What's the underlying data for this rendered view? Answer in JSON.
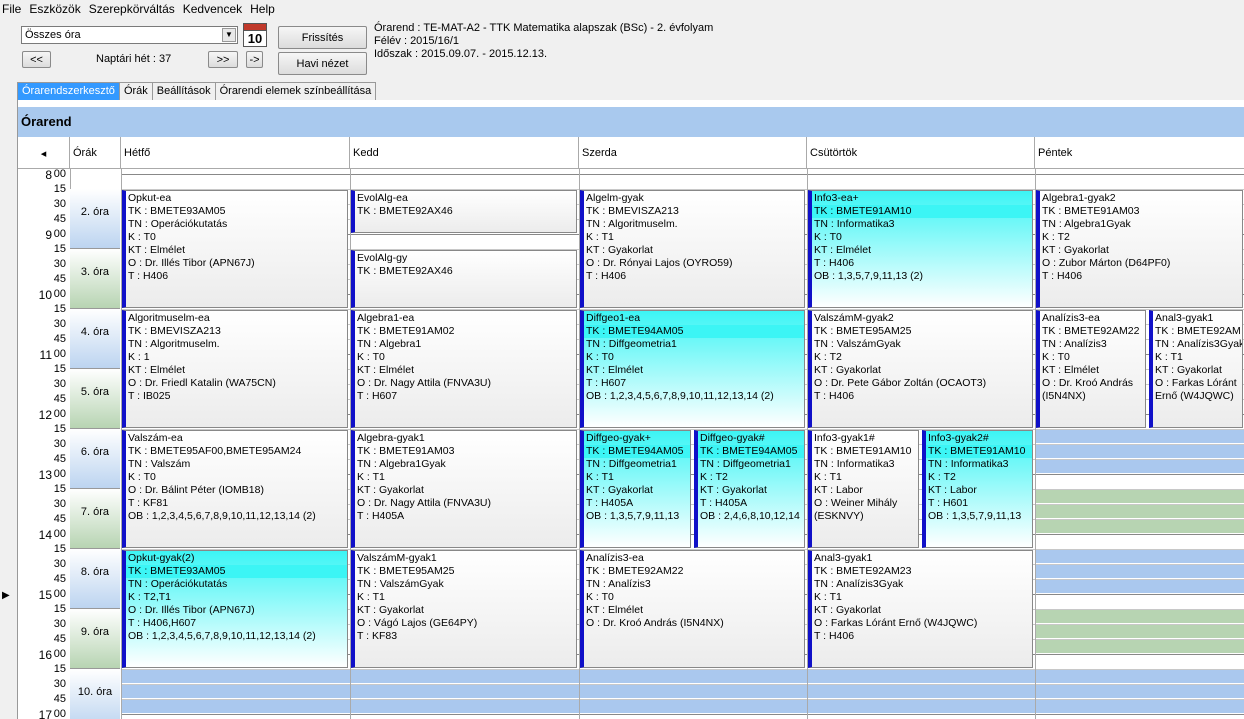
{
  "menu": [
    "File",
    "Eszközök",
    "Szerepkörváltás",
    "Kedvencek",
    "Help"
  ],
  "toolbar": {
    "combo": "Összes óra",
    "prev": "<<",
    "next": ">>",
    "next_single": "->",
    "week": "Naptári hét : 37",
    "cal_num": "10",
    "refresh": "Frissítés",
    "monthly": "Havi nézet",
    "info_line1": "Órarend : TE-MAT-A2 - TTK Matematika alapszak (BSc) - 2. évfolyam",
    "info_line2": "Félév : 2015/16/1",
    "info_line3": "Időszak : 2015.09.07. - 2015.12.13."
  },
  "tabs": [
    "Órarendszerkesztő",
    "Órák",
    "Beállítások",
    "Órarendi elemek színbeállítása"
  ],
  "title": "Órarend",
  "headers": {
    "nav": "◂",
    "orak": "Órák",
    "days": [
      "Hétfő",
      "Kedd",
      "Szerda",
      "Csütörtök",
      "Péntek"
    ]
  },
  "times": {
    "hours": [
      "8",
      "9",
      "10",
      "11",
      "12",
      "13",
      "14",
      "15",
      "16",
      "17"
    ],
    "mins": [
      "00",
      "15",
      "30",
      "45"
    ]
  },
  "ora_labels": [
    "2. óra",
    "3. óra",
    "4. óra",
    "5. óra",
    "6. óra",
    "7. óra",
    "8. óra",
    "9. óra",
    "10. óra"
  ],
  "events": [
    {
      "lines": [
        "Opkut-ea",
        "TK : BMETE93AM05",
        "TN : Operációkutatás",
        "K : T0",
        "KT : Elmélet",
        "O :  Dr. Illés Tibor (APN67J)",
        "T : H406"
      ]
    },
    {
      "lines": [
        "EvolAlg-ea",
        "TK : BMETE92AX46"
      ]
    },
    {
      "lines": [
        "EvolAlg-gy",
        "TK : BMETE92AX46"
      ]
    },
    {
      "lines": [
        "Algelm-gyak",
        "TK : BMEVISZA213",
        "TN : Algoritmuselm.",
        "K : T1",
        "KT : Gyakorlat",
        "O :  Dr. Rónyai Lajos (OYRO59)",
        "T : H406"
      ]
    },
    {
      "lines": [
        "Info3-ea+",
        "TK : BMETE91AM10",
        "TN : Informatika3",
        "K : T0",
        "KT : Elmélet",
        "T : H406",
        "OB : 1,3,5,7,9,11,13 (2)"
      ]
    },
    {
      "lines": [
        "Algebra1-gyak2",
        "TK : BMETE91AM03",
        "TN : Algebra1Gyak",
        "K : T2",
        "KT : Gyakorlat",
        "O :  Zubor Márton (D64PF0)",
        "T : H406"
      ]
    },
    {
      "lines": [
        "Algoritmuselm-ea",
        "TK : BMEVISZA213",
        "TN : Algoritmuselm.",
        "K : 1",
        "KT : Elmélet",
        "O :  Dr. Friedl Katalin (WA75CN)",
        "T : IB025"
      ]
    },
    {
      "lines": [
        "Algebra1-ea",
        "TK : BMETE91AM02",
        "TN : Algebra1",
        "K : T0",
        "KT : Elmélet",
        "O :  Dr. Nagy Attila (FNVA3U)",
        "T : H607"
      ]
    },
    {
      "lines": [
        "Diffgeo1-ea",
        "TK : BMETE94AM05",
        "TN : Diffgeometria1",
        "K : T0",
        "KT : Elmélet",
        "T : H607",
        "OB : 1,2,3,4,5,6,7,8,9,10,11,12,13,14 (2)"
      ]
    },
    {
      "lines": [
        "ValszámM-gyak2",
        "TK : BMETE95AM25",
        "TN : ValszámGyak",
        "K : T2",
        "KT : Gyakorlat",
        "O :  Dr. Pete Gábor Zoltán (OCAOT3)",
        "T : H406"
      ]
    },
    {
      "lines": [
        "Analízis3-ea",
        "TK : BMETE92AM22",
        "TN : Analízis3",
        "K : T0",
        "KT : Elmélet",
        "O :  Dr. Kroó András",
        "(I5N4NX)"
      ]
    },
    {
      "lines": [
        "Anal3-gyak1",
        "TK : BMETE92AM",
        "TN : Analízis3Gyak",
        "K : T1",
        "KT : Gyakorlat",
        "O :  Farkas Lóránt",
        "Ernő (W4JQWC)"
      ]
    },
    {
      "lines": [
        "Valszám-ea",
        "TK : BMETE95AF00,BMETE95AM24",
        "TN : Valszám",
        "K : T0",
        "O :  Dr. Bálint Péter (IOMB18)",
        "T : KF81",
        "OB : 1,2,3,4,5,6,7,8,9,10,11,12,13,14 (2)"
      ]
    },
    {
      "lines": [
        "Algebra-gyak1",
        "TK : BMETE91AM03",
        "TN : Algebra1Gyak",
        "K : T1",
        "KT : Gyakorlat",
        "O :  Dr. Nagy Attila (FNVA3U)",
        "T : H405A"
      ]
    },
    {
      "lines": [
        "Diffgeo-gyak+",
        "TK : BMETE94AM05",
        "TN : Diffgeometria1",
        "K : T1",
        "KT : Gyakorlat",
        "T : H405A",
        "OB : 1,3,5,7,9,11,13"
      ]
    },
    {
      "lines": [
        "Diffgeo-gyak#",
        "TK : BMETE94AM05",
        "TN : Diffgeometria1",
        "K : T2",
        "KT : Gyakorlat",
        "T : H405A",
        "OB : 2,4,6,8,10,12,14"
      ]
    },
    {
      "lines": [
        "Info3-gyak1#",
        "TK : BMETE91AM10",
        "TN : Informatika3",
        "K : T1",
        "KT : Labor",
        "O :  Weiner Mihály",
        "(ESKNVY)"
      ]
    },
    {
      "lines": [
        "Info3-gyak2#",
        "TK : BMETE91AM10",
        "TN : Informatika3",
        "K : T2",
        "KT : Labor",
        "T : H601",
        "OB : 1,3,5,7,9,11,13"
      ]
    },
    {
      "lines": [
        "Opkut-gyak(2)",
        "TK : BMETE93AM05",
        "TN : Operációkutatás",
        "K : T2,T1",
        "O :  Dr. Illés Tibor (APN67J)",
        "T : H406,H607",
        "OB : 1,2,3,4,5,6,7,8,9,10,11,12,13,14 (2)"
      ]
    },
    {
      "lines": [
        "ValszámM-gyak1",
        "TK : BMETE95AM25",
        "TN : ValszámGyak",
        "K : T1",
        "KT : Gyakorlat",
        "O :  Vágó Lajos (GE64PY)",
        "T : KF83"
      ]
    },
    {
      "lines": [
        "Analízis3-ea",
        "TK : BMETE92AM22",
        "TN : Analízis3",
        "K : T0",
        "KT : Elmélet",
        "O :  Dr. Kroó András (I5N4NX)"
      ]
    },
    {
      "lines": [
        "Anal3-gyak1",
        "TK : BMETE92AM23",
        "TN : Analízis3Gyak",
        "K : T1",
        "KT : Gyakorlat",
        "O :  Farkas Lóránt Ernő (W4JQWC)",
        "T : H406"
      ]
    }
  ],
  "colors": {
    "blue_band": "#aac8ee",
    "green_band": "#b7d4b2",
    "highlight": "#3cf5f5",
    "accent": "#1010c8"
  }
}
